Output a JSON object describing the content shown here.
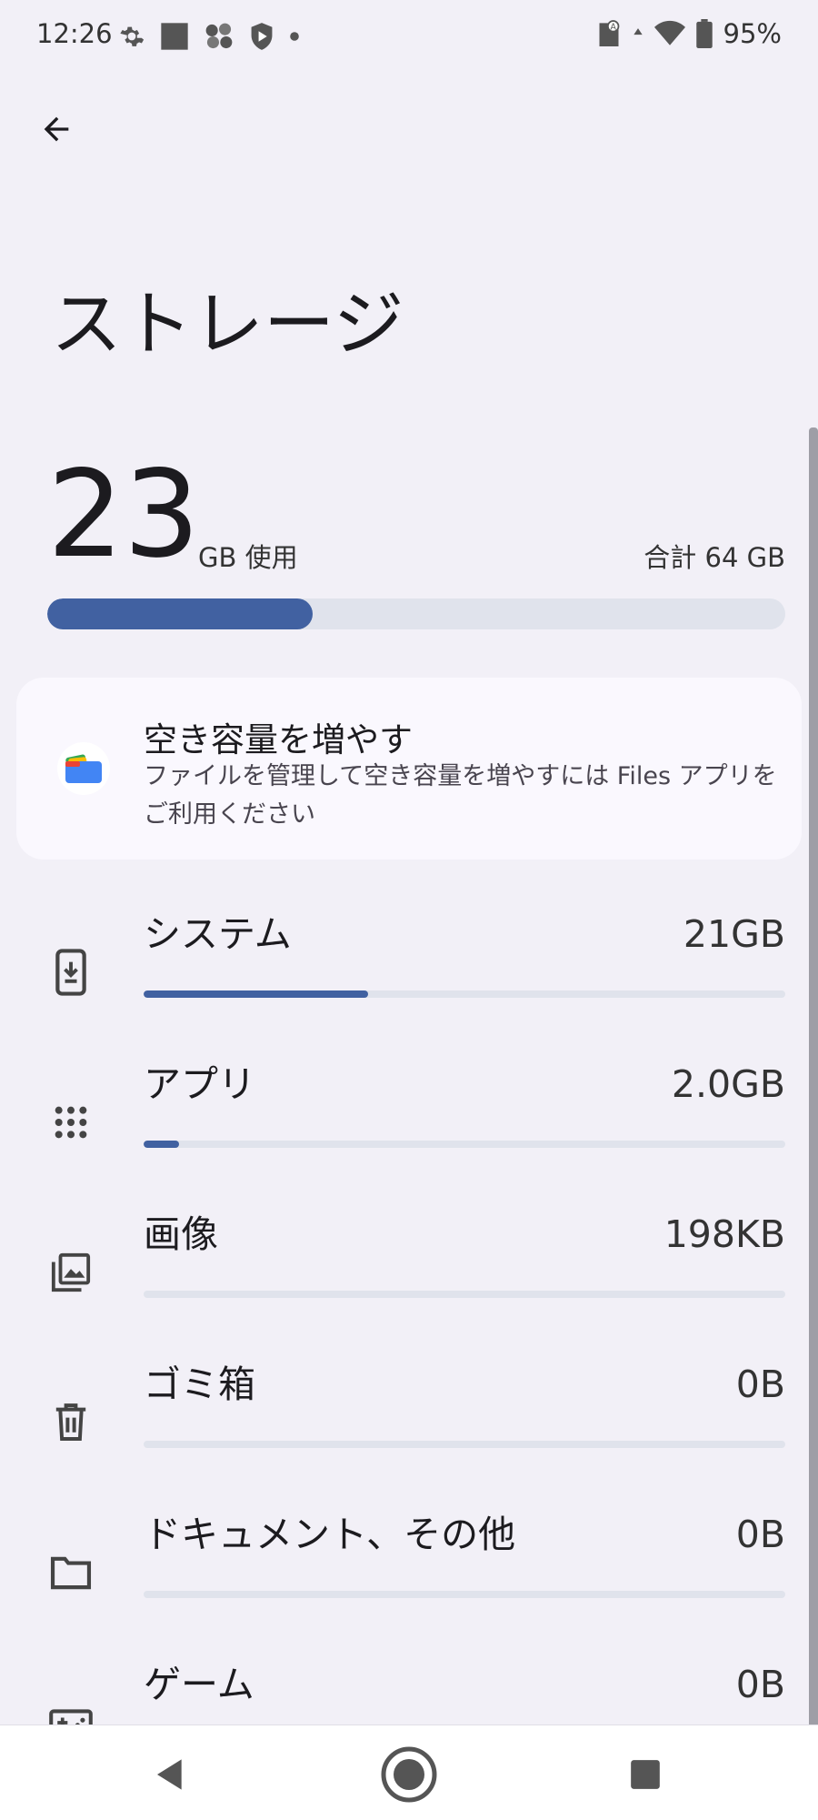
{
  "status_bar": {
    "time": "12:26",
    "battery": "95%",
    "left_icons": [
      "gear-icon",
      "square-icon",
      "cluster-icon",
      "shield-play-icon",
      "dot-icon"
    ],
    "right_icons": [
      "sim-icon",
      "data-arrow-icon",
      "wifi-icon",
      "battery-icon"
    ]
  },
  "header": {
    "back_icon": "arrow-back-icon",
    "title": "ストレージ"
  },
  "summary": {
    "used_value": "23",
    "used_unit": "GB 使用",
    "total": "合計 64 GB",
    "used_fraction": 0.359
  },
  "tip_card": {
    "icon": "files-app-icon",
    "title": "空き容量を増やす",
    "description": "ファイルを管理して空き容量を増やすには Files アプリをご利用ください"
  },
  "categories": [
    {
      "icon": "phone-download-icon",
      "name": "システム",
      "size": "21GB",
      "fraction": 0.35
    },
    {
      "icon": "apps-grid-icon",
      "name": "アプリ",
      "size": "2.0GB",
      "fraction": 0.055
    },
    {
      "icon": "images-icon",
      "name": "画像",
      "size": "198KB",
      "fraction": 0
    },
    {
      "icon": "trash-icon",
      "name": "ゴミ箱",
      "size": "0B",
      "fraction": 0
    },
    {
      "icon": "folder-icon",
      "name": "ドキュメント、その他",
      "size": "0B",
      "fraction": 0
    },
    {
      "icon": "gamepad-icon",
      "name": "ゲーム",
      "size": "0B",
      "fraction": 0
    }
  ],
  "nav": {
    "back_icon": "nav-back-icon",
    "home_icon": "nav-home-icon",
    "recents_icon": "nav-recents-icon"
  },
  "colors": {
    "accent": "#4161a1",
    "track": "#e0e3ec",
    "background": "#f2f0f7",
    "card": "#faf8fe"
  }
}
